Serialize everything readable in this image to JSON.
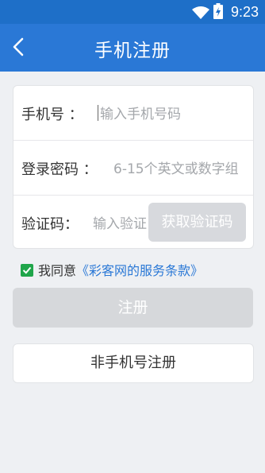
{
  "status_bar": {
    "time": "9:23",
    "icons": [
      "wifi-icon",
      "battery-charging-icon"
    ]
  },
  "app_bar": {
    "title": "手机注册",
    "back_icon": "chevron-left-icon"
  },
  "form": {
    "phone": {
      "label": "手机号 ：",
      "placeholder": "输入手机号码"
    },
    "password": {
      "label": "登录密码 ：",
      "placeholder": "6-15个英文或数字组"
    },
    "code": {
      "label": "验证码：",
      "placeholder": "输入验证",
      "button_label": "获取验证码"
    }
  },
  "agreement": {
    "checked": true,
    "text": "我同意",
    "link_text": "《彩客网的服务条款》"
  },
  "register_button": {
    "label": "注册"
  },
  "alt_register_button": {
    "label": "非手机号注册"
  },
  "colors": {
    "primary": "#2a78d6",
    "status_bar": "#1e6fc8",
    "checkbox": "#1fa54a",
    "disabled": "#d6d8db"
  }
}
